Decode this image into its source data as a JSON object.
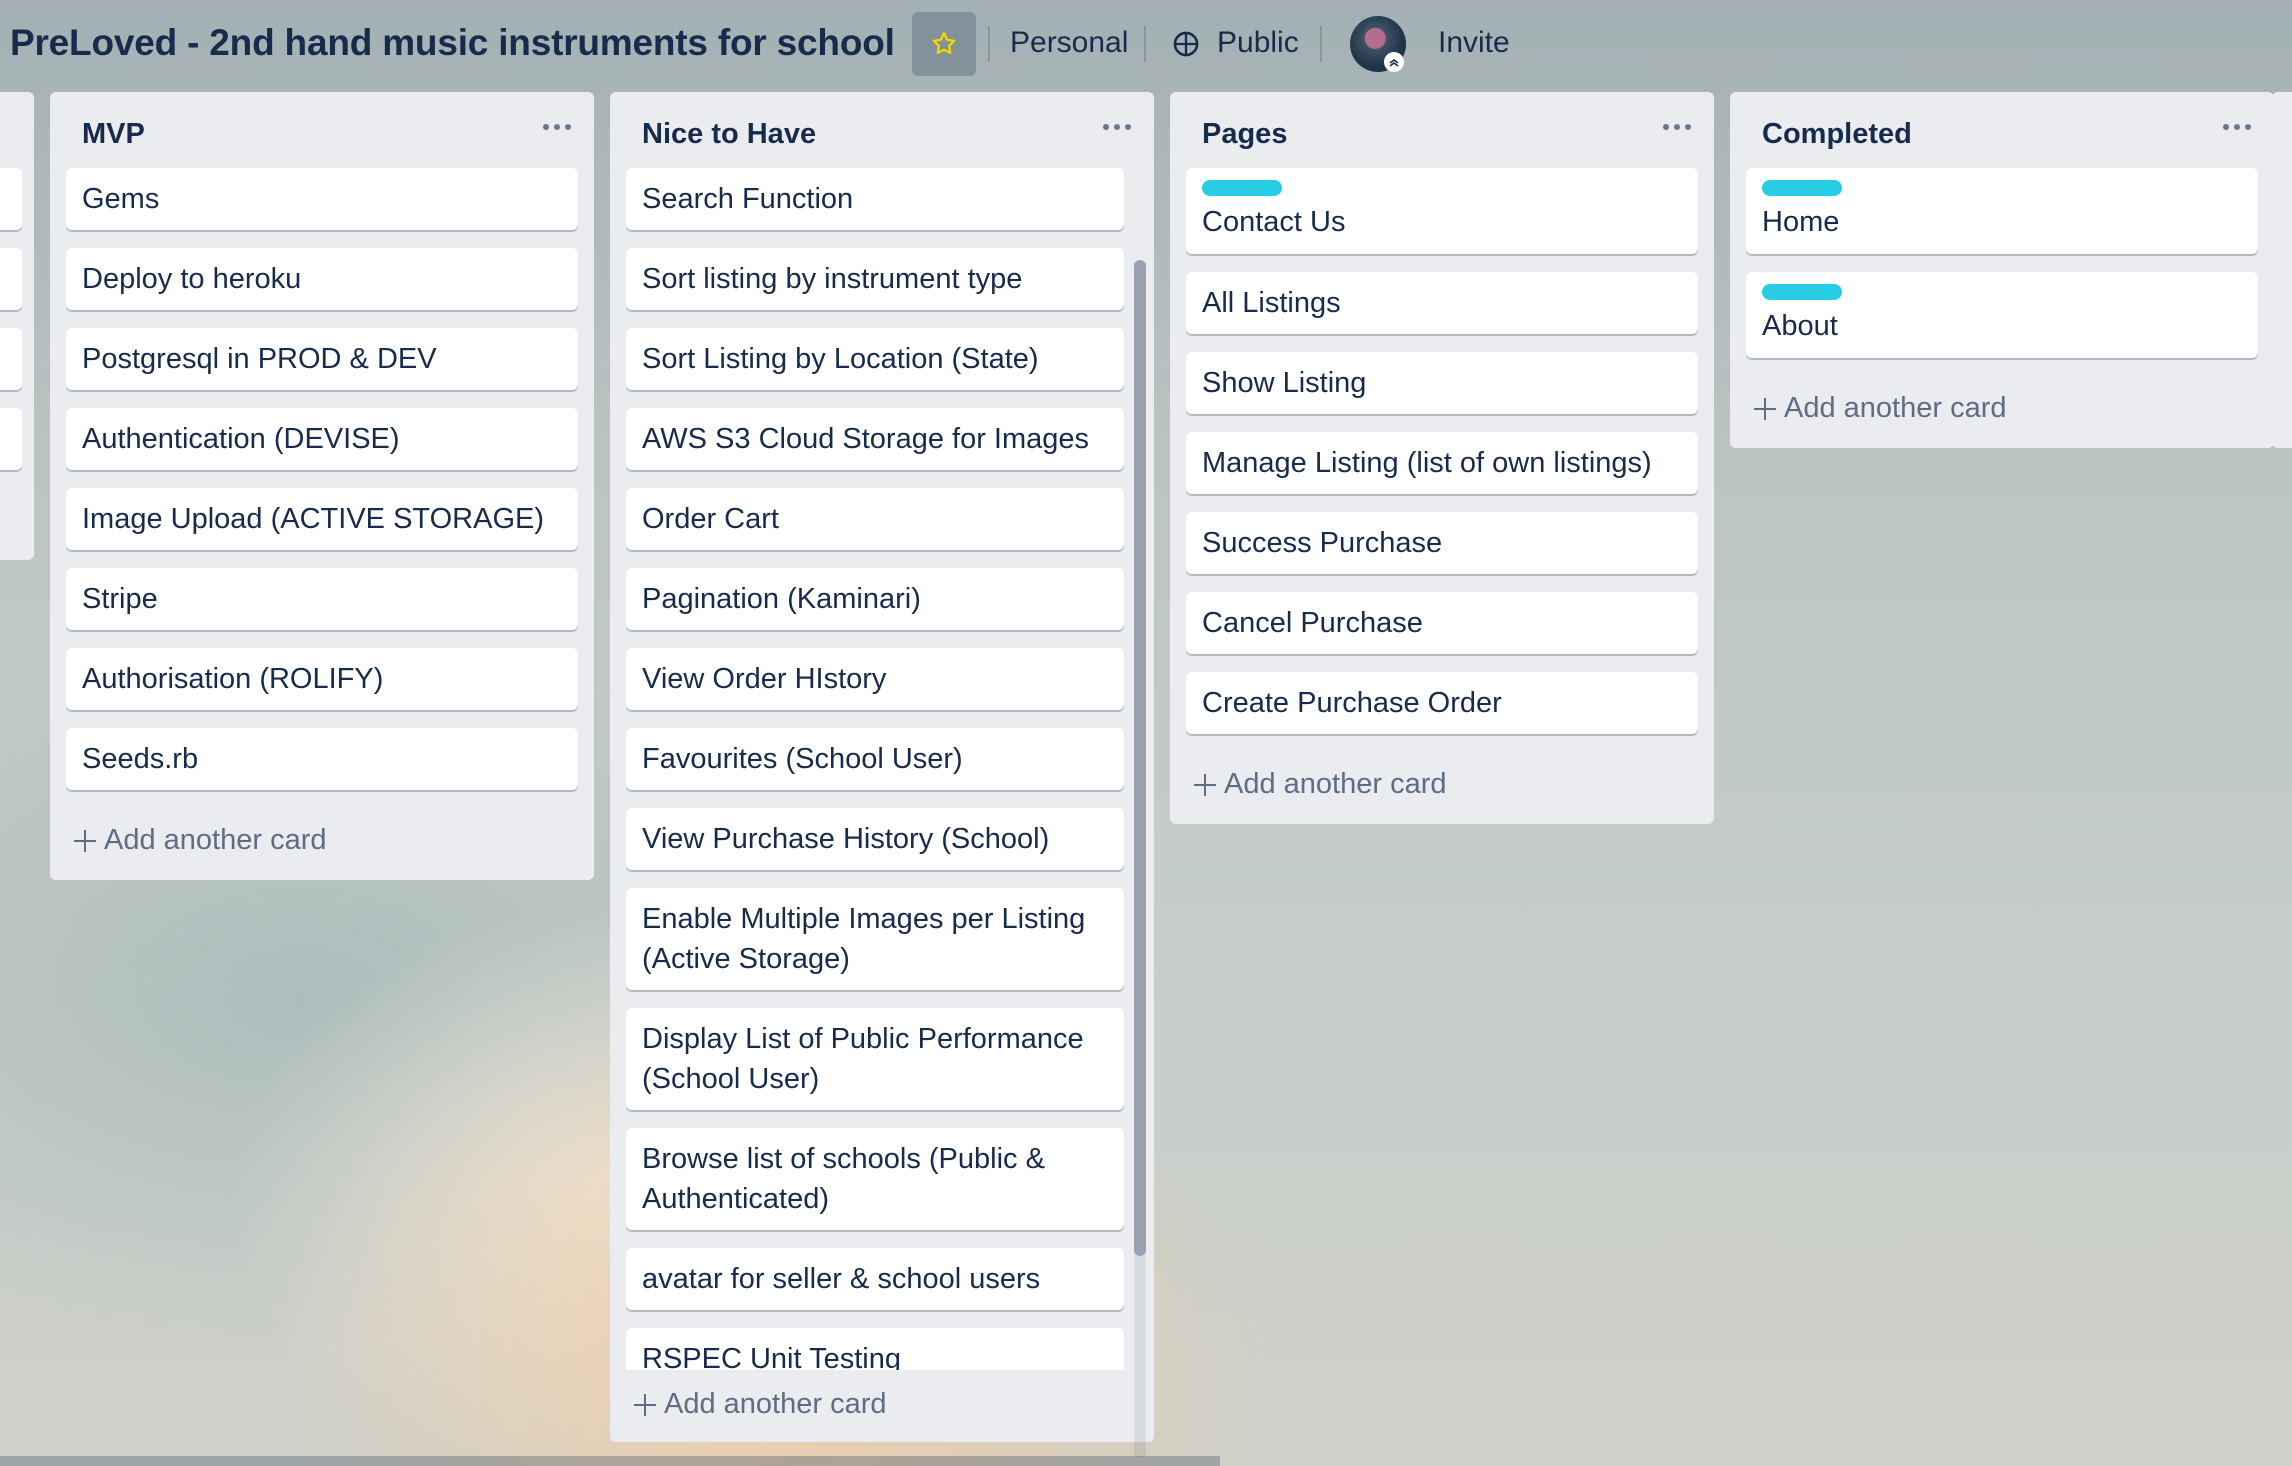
{
  "header": {
    "board_title": "PreLoved - 2nd hand music instruments for school",
    "visibility_team": "Personal",
    "visibility_public": "Public",
    "invite_label": "Invite"
  },
  "colors": {
    "label_cyan": "#29cce5",
    "star": "#f2d600"
  },
  "icons": [
    "star-icon",
    "globe-icon",
    "ellipsis-icon",
    "plus-icon"
  ],
  "lists": {
    "mvp": {
      "title": "MVP",
      "cards": [
        "Gems",
        "Deploy to heroku",
        "Postgresql in PROD & DEV",
        "Authentication (DEVISE)",
        "Image Upload (ACTIVE STORAGE)",
        "Stripe",
        "Authorisation (ROLIFY)",
        "Seeds.rb"
      ],
      "add_label": "Add another card"
    },
    "nice": {
      "title": "Nice to Have",
      "cards": [
        "Search Function",
        "Sort listing by instrument type",
        "Sort Listing by Location (State)",
        "AWS S3 Cloud Storage for Images",
        "Order Cart",
        "Pagination (Kaminari)",
        "View Order HIstory",
        "Favourites (School User)",
        "View Purchase History (School)",
        "Enable Multiple Images per Listing (Active Storage)",
        "Display List of Public Performance (School User)",
        "Browse list of schools (Public & Authenticated)",
        "avatar for seller & school users",
        "RSPEC Unit Testing"
      ],
      "add_label": "Add another card"
    },
    "pages": {
      "title": "Pages",
      "cards": [
        "Contact Us",
        "All Listings",
        "Show Listing",
        "Manage Listing (list of own listings)",
        "Success Purchase",
        "Cancel Purchase",
        "Create Purchase Order"
      ],
      "add_label": "Add another card"
    },
    "completed": {
      "title": "Completed",
      "cards": [
        "Home",
        "About"
      ],
      "add_label": "Add another card"
    }
  }
}
